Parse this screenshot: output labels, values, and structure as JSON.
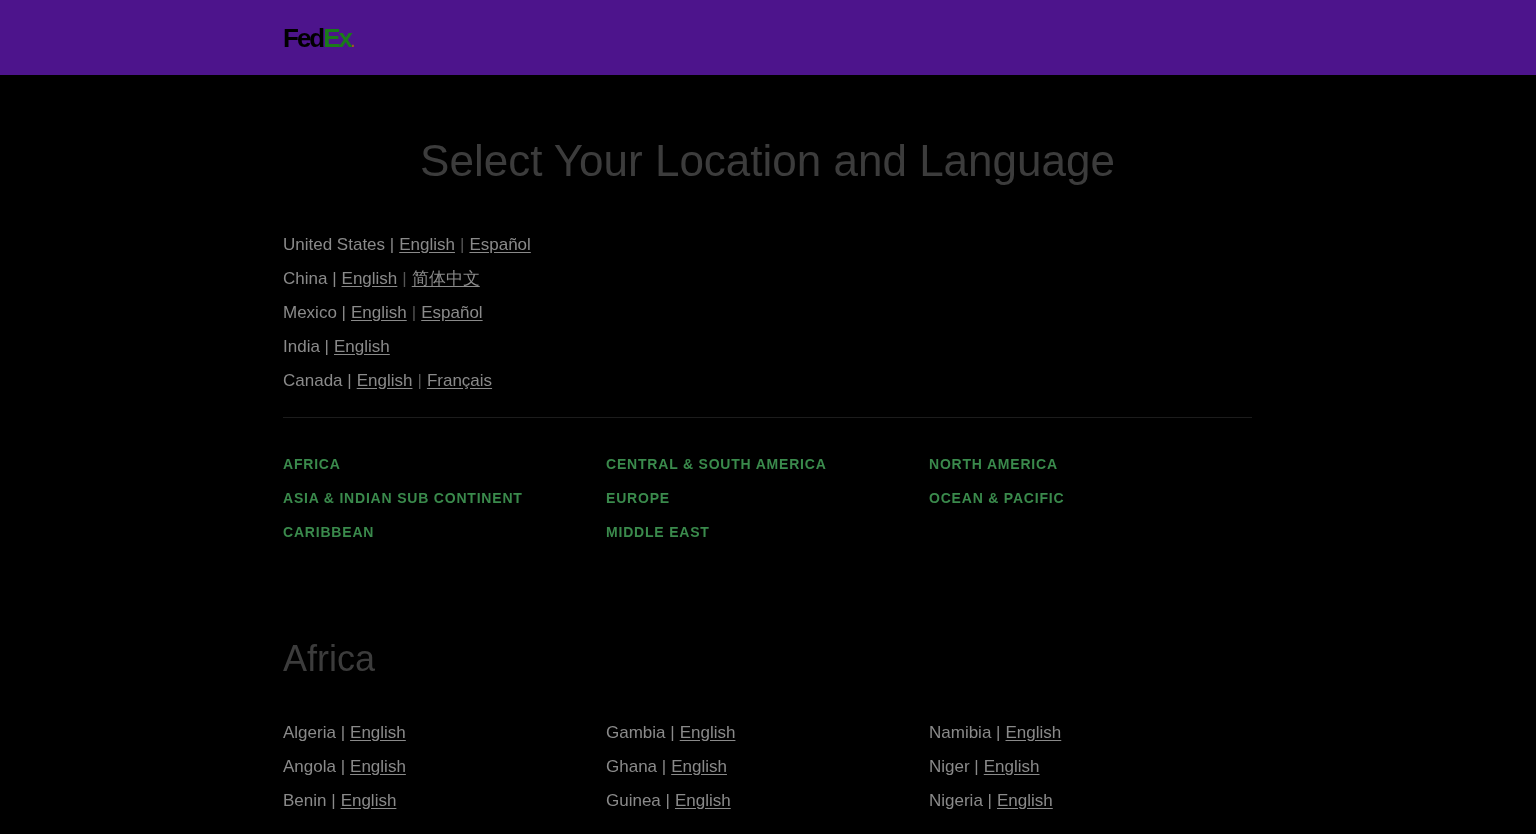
{
  "header": {
    "logo": {
      "left": "Fed",
      "right": "Ex",
      "dot": "."
    }
  },
  "title": "Select Your Location and Language",
  "featured": [
    {
      "country": "United States |",
      "languages": [
        {
          "label": "English"
        },
        {
          "sep": "|",
          "label": "Español"
        }
      ]
    },
    {
      "country": "China |",
      "languages": [
        {
          "label": "English"
        },
        {
          "sep": "|",
          "label": "简体中文"
        }
      ]
    },
    {
      "country": "Mexico |",
      "languages": [
        {
          "label": "English"
        },
        {
          "sep": "|",
          "label": "Español"
        }
      ]
    },
    {
      "country": "India |",
      "languages": [
        {
          "label": "English"
        }
      ]
    },
    {
      "country": "Canada |",
      "languages": [
        {
          "label": "English"
        },
        {
          "sep": "|",
          "label": "Français"
        }
      ]
    }
  ],
  "regions": [
    [
      "AFRICA",
      "ASIA & INDIAN SUB CONTINENT",
      "CARIBBEAN"
    ],
    [
      "CENTRAL & SOUTH AMERICA",
      "EUROPE",
      "MIDDLE EAST"
    ],
    [
      "NORTH AMERICA",
      "OCEAN & PACIFIC"
    ]
  ],
  "section": {
    "title": "Africa",
    "columns": [
      [
        {
          "country": "Algeria |",
          "languages": [
            {
              "label": "English"
            }
          ]
        },
        {
          "country": "Angola |",
          "languages": [
            {
              "label": "English"
            }
          ]
        },
        {
          "country": "Benin |",
          "languages": [
            {
              "label": "English"
            }
          ]
        }
      ],
      [
        {
          "country": "Gambia |",
          "languages": [
            {
              "label": "English"
            }
          ]
        },
        {
          "country": "Ghana |",
          "languages": [
            {
              "label": "English"
            }
          ]
        },
        {
          "country": "Guinea |",
          "languages": [
            {
              "label": "English"
            }
          ]
        }
      ],
      [
        {
          "country": "Namibia |",
          "languages": [
            {
              "label": "English"
            }
          ]
        },
        {
          "country": "Niger |",
          "languages": [
            {
              "label": "English"
            }
          ]
        },
        {
          "country": "Nigeria |",
          "languages": [
            {
              "label": "English"
            }
          ]
        }
      ]
    ]
  }
}
